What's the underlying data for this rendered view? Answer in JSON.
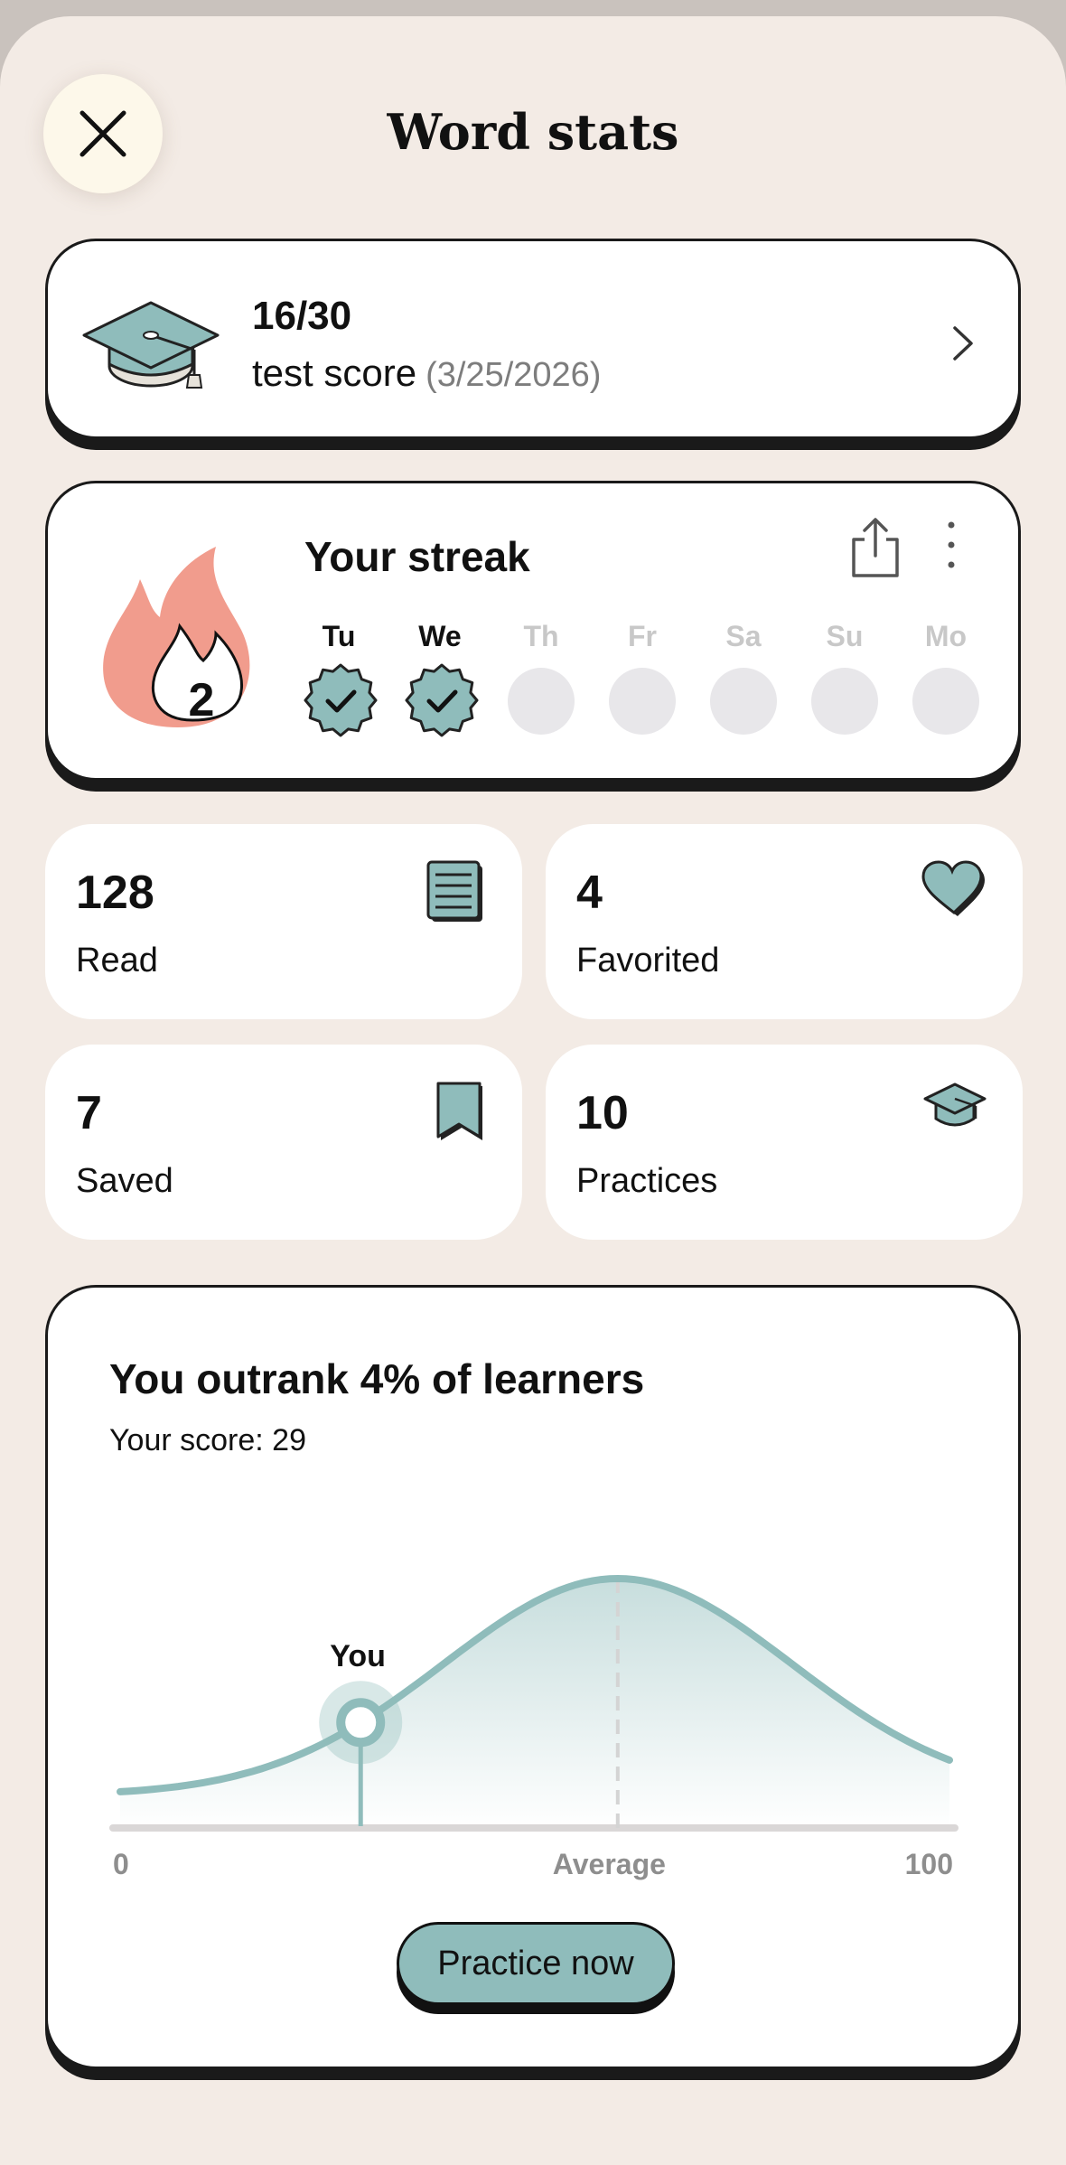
{
  "header": {
    "title": "Word stats",
    "close_icon": "close-icon"
  },
  "test_score": {
    "score": "16/30",
    "label": "test score",
    "date": "(3/25/2026)",
    "icon": "graduation-cap-icon"
  },
  "streak": {
    "title": "Your streak",
    "count": "2",
    "days": [
      {
        "label": "Tu",
        "done": true
      },
      {
        "label": "We",
        "done": true
      },
      {
        "label": "Th",
        "done": false
      },
      {
        "label": "Fr",
        "done": false
      },
      {
        "label": "Sa",
        "done": false
      },
      {
        "label": "Su",
        "done": false
      },
      {
        "label": "Mo",
        "done": false
      }
    ]
  },
  "stats": [
    {
      "value": "128",
      "label": "Read",
      "icon": "list-icon"
    },
    {
      "value": "4",
      "label": "Favorited",
      "icon": "heart-icon"
    },
    {
      "value": "7",
      "label": "Saved",
      "icon": "bookmark-icon"
    },
    {
      "value": "10",
      "label": "Practices",
      "icon": "graduation-cap-icon"
    }
  ],
  "rank": {
    "title": "You outrank 4% of learners",
    "score_text": "Your score: 29",
    "you_label": "You",
    "axis_min": "0",
    "axis_mid": "Average",
    "axis_max": "100",
    "your_score": 29,
    "average": 60,
    "button": "Practice now"
  },
  "colors": {
    "accent": "#8fbcbb",
    "flame": "#f19c8d",
    "background": "#f3ebe5",
    "inactive_day": "#e8e7ea"
  }
}
